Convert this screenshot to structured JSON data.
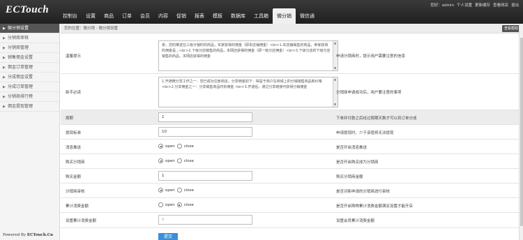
{
  "logo": {
    "text": "ECTouch"
  },
  "nav": {
    "items": [
      {
        "label": "控制台"
      },
      {
        "label": "设置"
      },
      {
        "label": "商品"
      },
      {
        "label": "订单"
      },
      {
        "label": "会员"
      },
      {
        "label": "内容"
      },
      {
        "label": "促销"
      },
      {
        "label": "报表"
      },
      {
        "label": "模板"
      },
      {
        "label": "数据库"
      },
      {
        "label": "工具箱"
      },
      {
        "label": "微分销"
      },
      {
        "label": "微信通"
      }
    ],
    "active": "微分销"
  },
  "topright": {
    "greeting": "您好：admin",
    "personal": "个人设置",
    "clear_cache": "更新缓存",
    "view_site": "查看网店",
    "logout": "退出"
  },
  "sidebar": {
    "items": [
      {
        "label": "微分销设置"
      },
      {
        "label": "分销商审核"
      },
      {
        "label": "分销商管理"
      },
      {
        "label": "销售佣金设置"
      },
      {
        "label": "佣金订单管理"
      },
      {
        "label": "分成佣金设置"
      },
      {
        "label": "分成订单管理"
      },
      {
        "label": "分销商排行榜"
      },
      {
        "label": "佣金提现管理"
      }
    ],
    "powered_prefix": "Powered By ",
    "powered_brand": "ECTouch.Cn"
  },
  "breadcrumb": "您的位置：微分销 - 微分销设置",
  "help_button": "查看帮助",
  "form": {
    "notice": {
      "label": "温馨提示",
      "value": "亲，您的推送在三级分销时的商品，买家获得的佣金（即本店铺佣金）<br>1.本店铺销售的商品，卖家获得的佣金是...<br>2.下级分店销售的商品，本网店获得的佣金（即一级分店佣金）<br>3.下级分店的下级分店销售的商品，本网店获得的佣金",
      "note": "申请分销商时，提示用户需要注意的信息"
    },
    "rules": {
      "label": "新手必读",
      "value": "1.开通微分享工作之一：您已成功注册商店，分享佣金如下：得益于商户在商城上的分销销售商品和价格<br>2.分享佣金之一：分享销售商品时有佣金 <br>3.开通后，通过分享链接可获得分销佣金",
      "note": "分销商申请成功后，用户要注意的事项"
    },
    "period": {
      "label": "周期",
      "value": "1",
      "note": "下单并付款之后经过周期天数才可以到订单分成"
    },
    "withdraw_min": {
      "label": "提现标准",
      "value": "10",
      "note": "申请提现时，少于该值将无法提现"
    },
    "msg_push": {
      "label": "消息推送",
      "opt_open": "open",
      "opt_close": "close",
      "selected": "open",
      "note": "是否开启消息推送"
    },
    "buy_distrib": {
      "label": "购买分销商",
      "opt_open": "open",
      "opt_close": "close",
      "selected": "open",
      "note": "是否开启购买成为分销商"
    },
    "buy_amount": {
      "label": "购买金额",
      "value": "1",
      "note": "购买分销商金额"
    },
    "audit": {
      "label": "分销商审核",
      "opt_open": "open",
      "opt_close": "close",
      "selected": "open",
      "note": "是否对新申请的分销商进行审核"
    },
    "consume": {
      "label": "累计消费金额",
      "opt_open": "open",
      "opt_close": "close",
      "selected": "close",
      "note": "是否开启购物累计消费金额满足设置才能开店"
    },
    "consume_amount": {
      "label": "设置累计消费金额",
      "value": "0",
      "note": "设置会员累计消费金额"
    },
    "submit": "提交"
  }
}
